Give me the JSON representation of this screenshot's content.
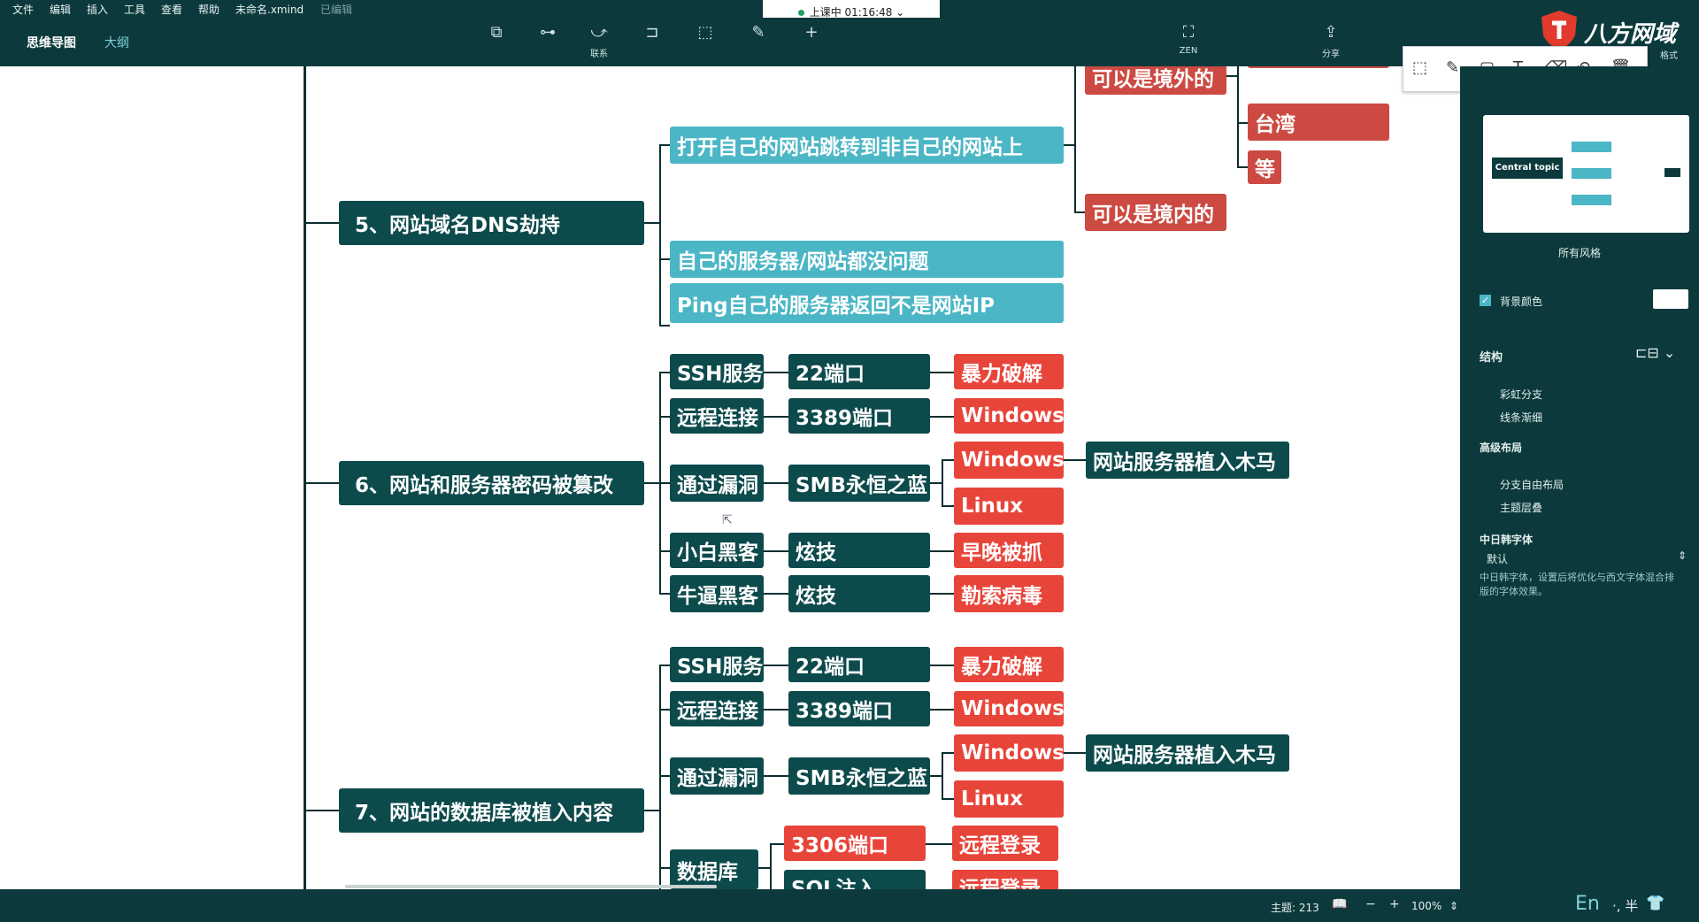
{
  "menubar": {
    "items": [
      "文件",
      "编辑",
      "插入",
      "工具",
      "查看",
      "帮助"
    ],
    "filename": "未命名.xmind",
    "status": "已编辑"
  },
  "toolbar": {
    "view_tabs": [
      "思维导图",
      "大纲"
    ],
    "link_label": "联系",
    "zen_label": "ZEN",
    "share_label": "分享",
    "format_label": "格式"
  },
  "recording": {
    "text": "上课中 01:16:48"
  },
  "watermark": {
    "text": "八方网域"
  },
  "mindmap": {
    "branch5": {
      "title": "5、网站域名DNS劫持",
      "children": [
        "打开自己的网站跳转到非自己的网站上",
        "自己的服务器/网站都没问题",
        "Ping自己的服务器返回不是网站IP"
      ],
      "sub": {
        "abroad": "可以是境外的",
        "domestic": "可以是境内的",
        "taiwan": "台湾",
        "etc": "等"
      }
    },
    "branch6": {
      "title": "6、网站和服务器密码被篡改",
      "rows": [
        {
          "a": "SSH服务",
          "b": "22端口",
          "c": "暴力破解"
        },
        {
          "a": "远程连接",
          "b": "3389端口",
          "c": "Windows"
        },
        {
          "a": "通过漏洞",
          "b": "SMB永恒之蓝",
          "c": "Windows",
          "c2": "Linux",
          "d": "网站服务器植入木马"
        },
        {
          "a": "小白黑客",
          "b": "炫技",
          "c": "早晚被抓"
        },
        {
          "a": "牛逼黑客",
          "b": "炫技",
          "c": "勒索病毒"
        }
      ]
    },
    "branch7": {
      "title": "7、网站的数据库被植入内容",
      "rows": [
        {
          "a": "SSH服务",
          "b": "22端口",
          "c": "暴力破解"
        },
        {
          "a": "远程连接",
          "b": "3389端口",
          "c": "Windows"
        },
        {
          "a": "通过漏洞",
          "b": "SMB永恒之蓝",
          "c": "Windows",
          "c2": "Linux",
          "d": "网站服务器植入木马"
        },
        {
          "a": "数据库",
          "b": "3306端口",
          "c": "远程登录",
          "b2": "SQL注入",
          "c3": "远程登录"
        }
      ]
    }
  },
  "panel": {
    "thumbnail_center": "Central topic",
    "style_label": "所有风格",
    "bg_color_label": "背景颜色",
    "structure_label": "结构",
    "rainbow_branch": "彩虹分支",
    "line_taper": "线条渐细",
    "advanced_layout": "高级布局",
    "free_layout": "分支自由布局",
    "topic_overlap": "主题层叠",
    "cjk_font_label": "中日韩字体",
    "cjk_font_value": "默认",
    "cjk_desc": "中日韩字体，设置后将优化与西文字体混合排版的字体效果。"
  },
  "statusbar": {
    "topics": "主题: 213",
    "zoom": "100%",
    "ime": "En"
  }
}
